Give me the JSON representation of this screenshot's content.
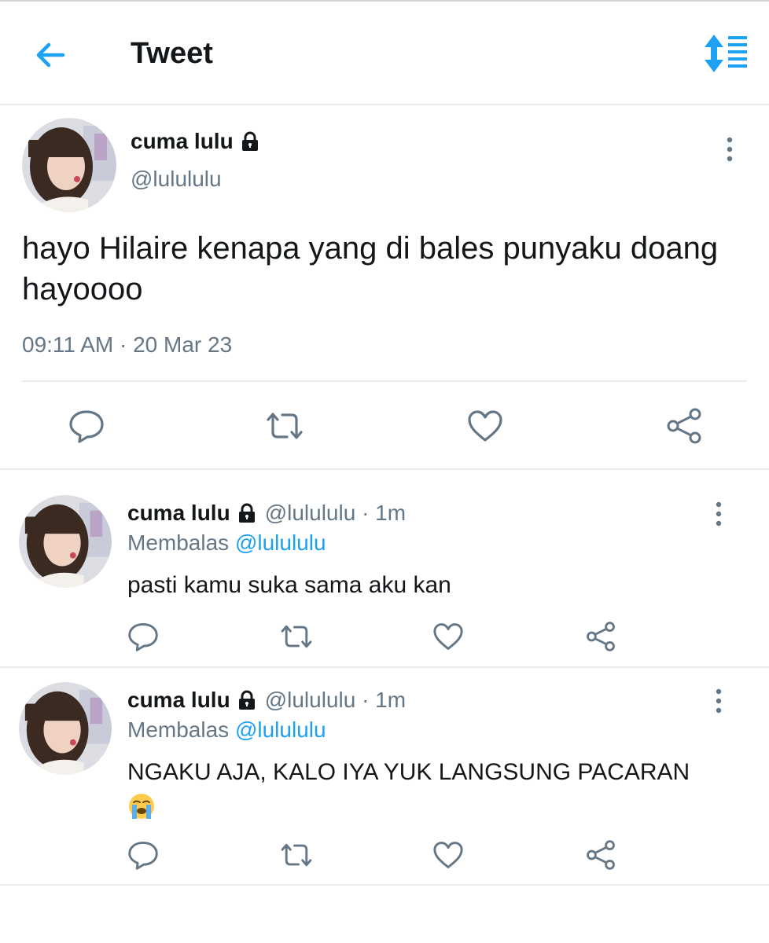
{
  "header": {
    "title": "Tweet",
    "back_icon": "arrow-left-icon",
    "sort_icon": "sort-replies-icon",
    "accent_color": "#1da1f2"
  },
  "main_tweet": {
    "author_name": "cuma lulu",
    "author_handle": "@lulululu",
    "locked_icon": "lock-icon",
    "text": "hayo Hilaire kenapa yang di bales punyaku doang hayoooo",
    "timestamp": "09:11 AM · 20 Mar 23",
    "actions": [
      "reply-icon",
      "retweet-icon",
      "like-icon",
      "share-icon"
    ]
  },
  "replies": [
    {
      "author_name": "cuma lulu",
      "meta": "@lulululu · 1m",
      "replying_label": "Membalas",
      "replying_to": "@lulululu",
      "text": "pasti kamu suka sama aku kan"
    },
    {
      "author_name": "cuma lulu",
      "meta": "@lulululu · 1m",
      "replying_label": "Membalas",
      "replying_to": "@lulululu",
      "text": "NGAKU AJA, KALO IYA YUK LANGSUNG PACARAN",
      "emoji": "loudly-crying-face-emoji"
    }
  ],
  "colors": {
    "text_primary": "#14171a",
    "text_secondary": "#657786",
    "icon_gray": "#657786",
    "divider": "#e6ecf0"
  }
}
